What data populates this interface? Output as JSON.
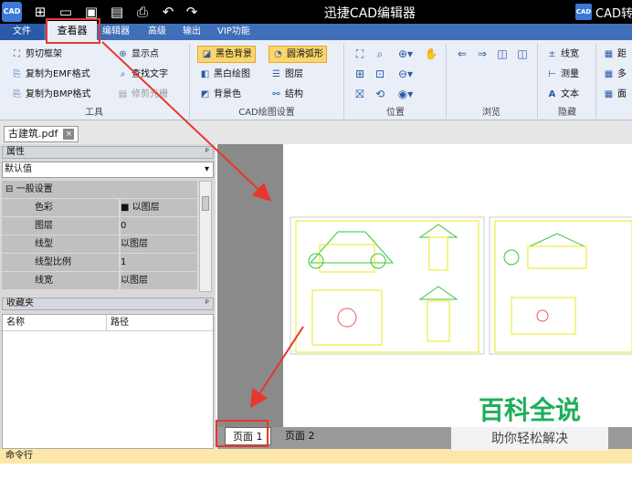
{
  "window": {
    "title": "迅捷CAD编辑器",
    "app_logo": "CAD",
    "app_title_right": "CAD转"
  },
  "quick_access": [
    "new-icon",
    "open-icon",
    "save-icon",
    "saveas-icon",
    "print-icon",
    "undo-icon",
    "redo-icon"
  ],
  "menu": {
    "file": "文件",
    "view": "查看器",
    "edit": "编辑器",
    "advanced": "高级",
    "output": "输出",
    "vip": "VIP功能"
  },
  "ribbon": {
    "tools": {
      "clip": "剪切框架",
      "emf": "复制为EMF格式",
      "bmp": "复制为BMP格式",
      "show_points": "显示点",
      "find_text": "查找文字",
      "trim_raster": "修剪光栅",
      "group": "工具"
    },
    "cad_settings": {
      "black_bg": "黑色背景",
      "smooth_arc": "圆滑弧形",
      "bw_drawing": "黑白绘图",
      "layers": "图层",
      "bg_color": "背景色",
      "structure": "结构",
      "group": "CAD绘图设置"
    },
    "position": {
      "group": "位置"
    },
    "browse": {
      "group": "浏览"
    },
    "hide": {
      "line_width": "线宽",
      "measure": "测量",
      "text": "文本",
      "group": "隐藏"
    },
    "more": {
      "a": "距",
      "b": "多",
      "c": "面"
    }
  },
  "doc_tab": {
    "name": "古建筑.pdf",
    "close": "×"
  },
  "properties": {
    "header": "属性",
    "pin": "ᵖ",
    "combo": "默认值",
    "section": "一般设置",
    "section_toggle": "⊟",
    "rows": [
      {
        "key": "色彩",
        "value": "■ 以图层"
      },
      {
        "key": "图层",
        "value": "0"
      },
      {
        "key": "线型",
        "value": "以图层"
      },
      {
        "key": "线型比例",
        "value": "1"
      },
      {
        "key": "线宽",
        "value": "以图层"
      }
    ]
  },
  "favorites": {
    "header": "收藏夹",
    "pin": "ᵖ",
    "col_name": "名称",
    "col_path": "路径"
  },
  "pages": {
    "page1": "页面 1",
    "page2": "页面 2"
  },
  "command": {
    "label": "命令行"
  },
  "watermark": {
    "main": "百科全说",
    "sub": "助你轻松解决"
  },
  "colors": {
    "title_bg": "#000000",
    "menu_bg": "#3f6fb8",
    "ribbon_bg": "#eaeff7",
    "highlight": "#fbd66a",
    "annotation_red": "#e8372e",
    "cad_yellow": "#e8e81a",
    "cad_green": "#39c439"
  }
}
